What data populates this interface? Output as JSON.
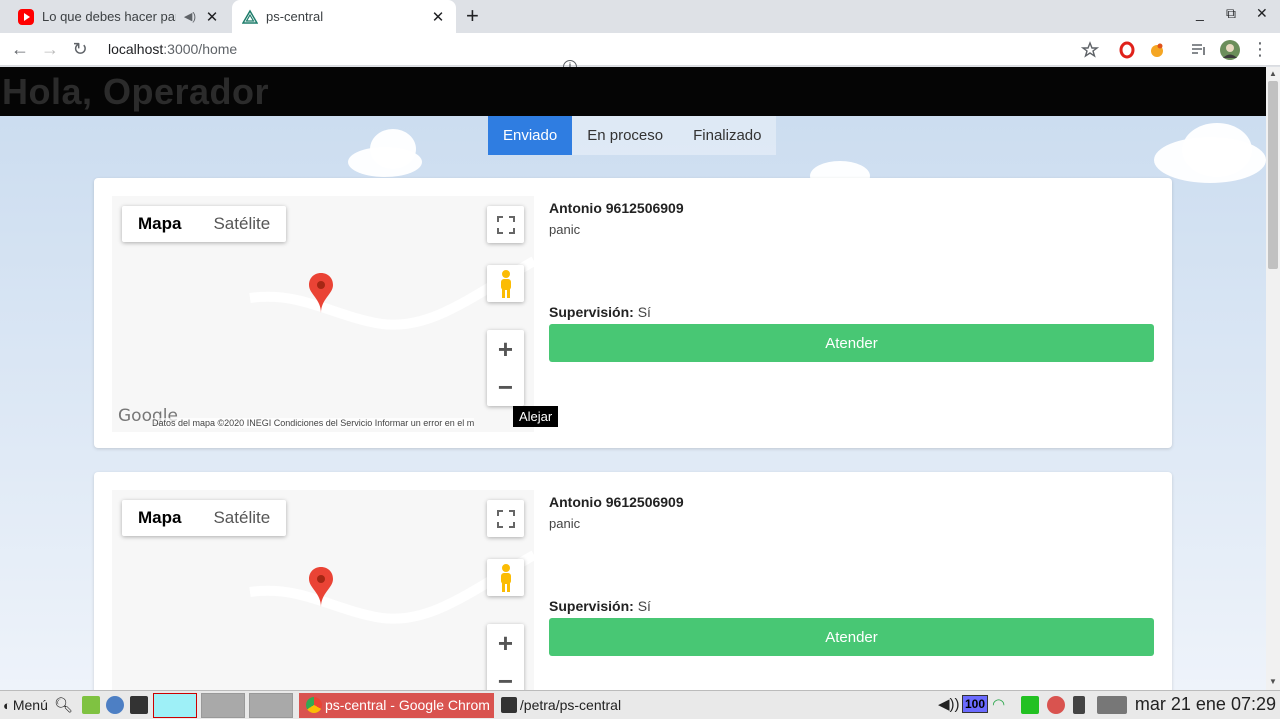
{
  "browser": {
    "tabs": [
      {
        "title": "Lo que debes hacer par",
        "icon": "youtube-icon",
        "audio": true
      },
      {
        "title": "ps-central",
        "icon": "vuetify-icon",
        "active": true
      }
    ],
    "new_tab": "+",
    "window_controls": {
      "minimize": "_",
      "restore": "⧉",
      "close": "✕"
    },
    "url_host": "localhost",
    "url_path": ":3000/home"
  },
  "page": {
    "greeting": "Hola, Operador",
    "status_tabs": [
      "Enviado",
      "En proceso",
      "Finalizado"
    ],
    "active_tab": "Enviado",
    "map": {
      "type_map": "Mapa",
      "type_satellite": "Satélite",
      "footer": "Datos del mapa ©2020 INEGI   Condiciones del Servicio   Informar un error en el m",
      "logo": "Google",
      "zoom_in": "+",
      "zoom_out": "−"
    },
    "tooltip": "Alejar",
    "cards": [
      {
        "name": "Antonio",
        "phone": "9612506909",
        "type": "panic",
        "supervision_label": "Supervisión:",
        "supervision_value": "Sí",
        "button": "Atender"
      },
      {
        "name": "Antonio",
        "phone": "9612506909",
        "type": "panic",
        "supervision_label": "Supervisión:",
        "supervision_value": "Sí",
        "button": "Atender"
      }
    ]
  },
  "taskbar": {
    "menu": "Menú",
    "chrome_task": "ps-central - Google Chrom",
    "terminal_task": "/petra/ps-central",
    "battery": "100",
    "clock": "mar 21 ene 07:29"
  },
  "colors": {
    "accent": "#2f7de1",
    "button": "#48c774",
    "header": "#050505"
  }
}
